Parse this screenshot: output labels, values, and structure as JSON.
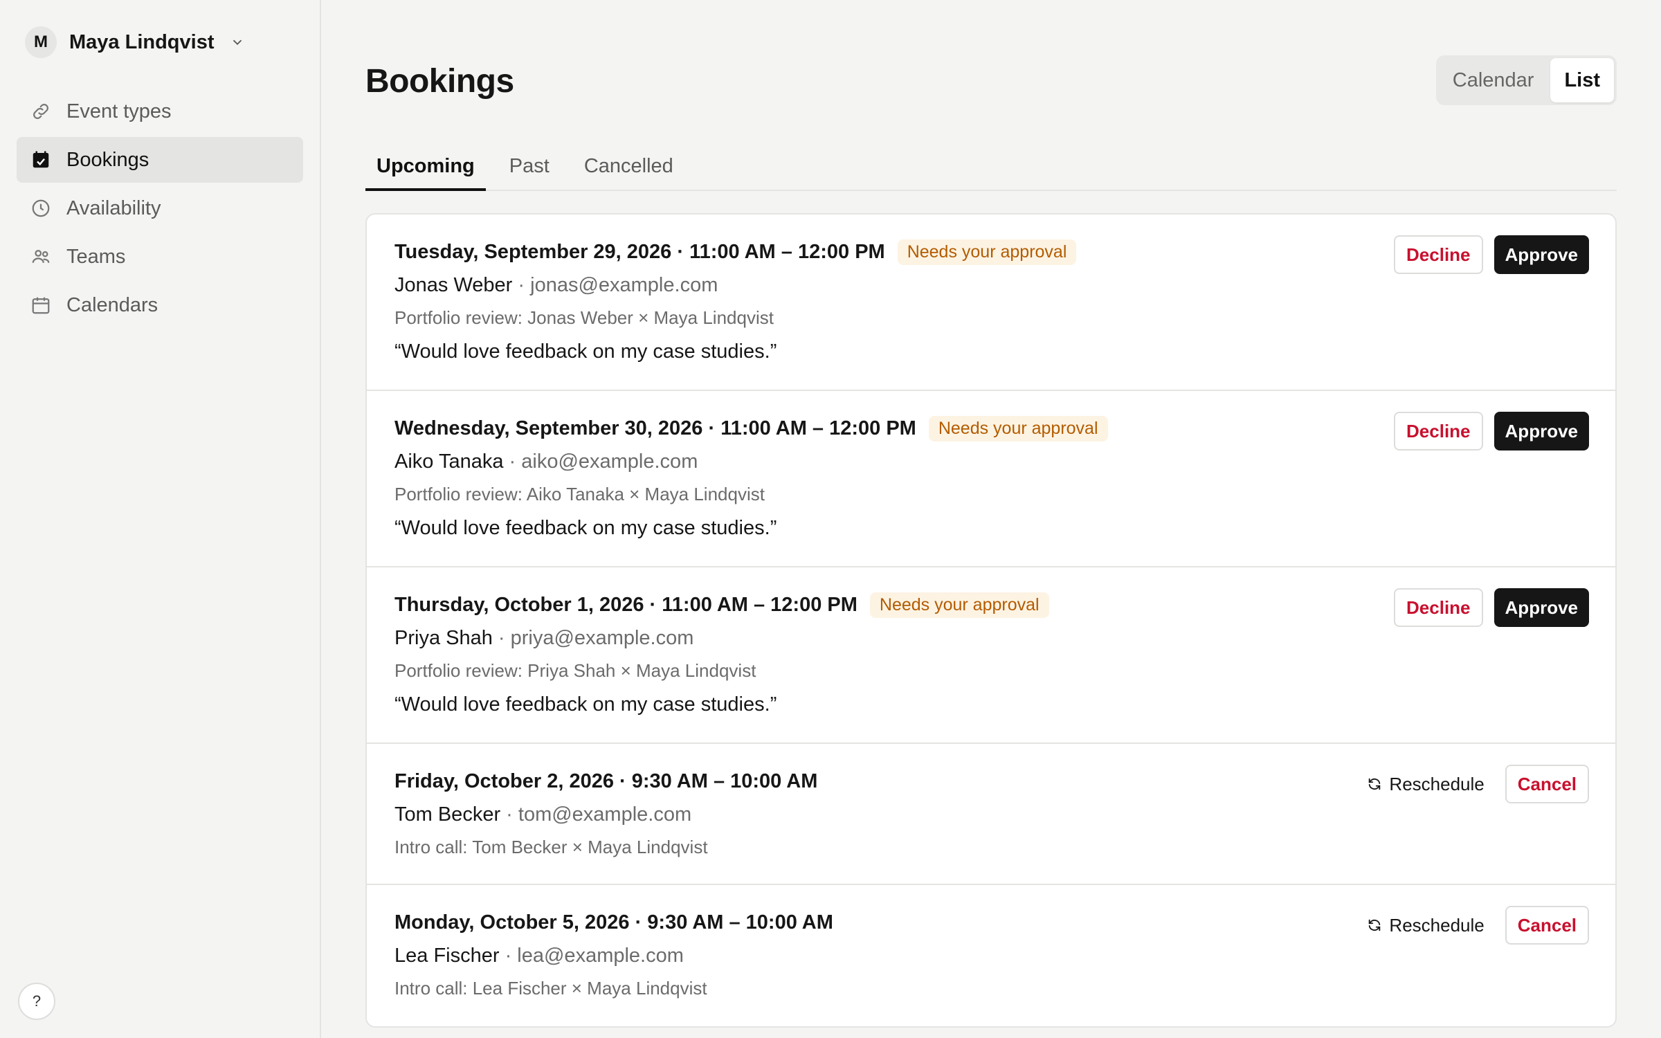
{
  "user": {
    "initial": "M",
    "name": "Maya Lindqvist"
  },
  "sidebar": {
    "items": [
      {
        "label": "Event types",
        "icon": "link-icon"
      },
      {
        "label": "Bookings",
        "icon": "calendar-check-icon"
      },
      {
        "label": "Availability",
        "icon": "clock-icon"
      },
      {
        "label": "Teams",
        "icon": "users-icon"
      },
      {
        "label": "Calendars",
        "icon": "calendar-icon"
      }
    ],
    "active": "Bookings",
    "help_label": "?"
  },
  "page": {
    "title": "Bookings"
  },
  "view_toggle": {
    "calendar": "Calendar",
    "list": "List",
    "active": "List"
  },
  "tabs": {
    "upcoming": "Upcoming",
    "past": "Past",
    "cancelled": "Cancelled",
    "active": "Upcoming"
  },
  "bookings": [
    {
      "when": "Tuesday, September 29, 2026 · 11:00 AM – 12:00 PM",
      "badge": "Needs your approval",
      "name": "Jonas Weber",
      "sep": " · ",
      "email": "jonas@example.com",
      "event": "Portfolio review: Jonas Weber × Maya Lindqvist",
      "note": "“Would love feedback on my case studies.”",
      "decline": "Decline",
      "approve": "Approve"
    },
    {
      "when": "Wednesday, September 30, 2026 · 11:00 AM – 12:00 PM",
      "badge": "Needs your approval",
      "name": "Aiko Tanaka",
      "sep": " · ",
      "email": "aiko@example.com",
      "event": "Portfolio review: Aiko Tanaka × Maya Lindqvist",
      "note": "“Would love feedback on my case studies.”",
      "decline": "Decline",
      "approve": "Approve"
    },
    {
      "when": "Thursday, October 1, 2026 · 11:00 AM – 12:00 PM",
      "badge": "Needs your approval",
      "name": "Priya Shah",
      "sep": " · ",
      "email": "priya@example.com",
      "event": "Portfolio review: Priya Shah × Maya Lindqvist",
      "note": "“Would love feedback on my case studies.”",
      "decline": "Decline",
      "approve": "Approve"
    },
    {
      "when": "Friday, October 2, 2026 · 9:30 AM – 10:00 AM",
      "name": "Tom Becker",
      "sep": " · ",
      "email": "tom@example.com",
      "event": "Intro call: Tom Becker × Maya Lindqvist",
      "reschedule": "Reschedule",
      "cancel": "Cancel"
    },
    {
      "when": "Monday, October 5, 2026 · 9:30 AM – 10:00 AM",
      "name": "Lea Fischer",
      "sep": " · ",
      "email": "lea@example.com",
      "event": "Intro call: Lea Fischer × Maya Lindqvist",
      "reschedule": "Reschedule",
      "cancel": "Cancel"
    }
  ],
  "colors": {
    "accent_dark": "#161616",
    "danger": "#c8102e",
    "badge_bg": "#fdf3e3",
    "badge_text": "#b35c00",
    "page_bg": "#f4f4f2"
  }
}
